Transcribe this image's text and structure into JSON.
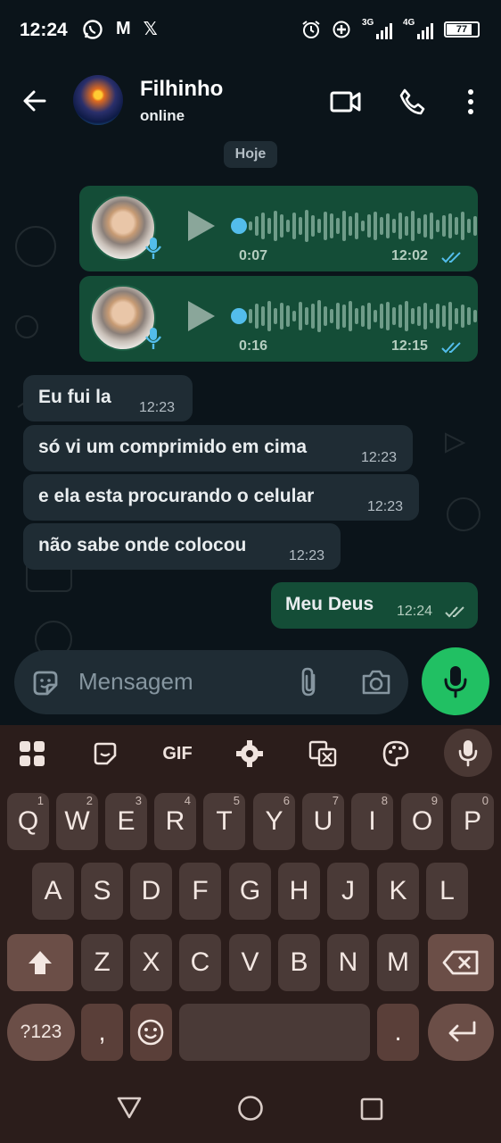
{
  "status_bar": {
    "time": "12:24",
    "left_icons": [
      "whatsapp-icon",
      "gmail-icon",
      "x-icon"
    ],
    "gmail_glyph": "M",
    "x_glyph": "𝕏",
    "network_1": "3G",
    "network_2": "4G",
    "battery": "77"
  },
  "header": {
    "contact_name": "Filhinho",
    "contact_status": "online"
  },
  "chat": {
    "date_chip": "Hoje",
    "voice_messages": [
      {
        "duration": "0:07",
        "time": "12:02",
        "read": true
      },
      {
        "duration": "0:16",
        "time": "12:15",
        "read": true
      }
    ],
    "incoming": [
      {
        "text": "Eu fui la",
        "time": "12:23"
      },
      {
        "text": "só vi um comprimido em cima",
        "time": "12:23"
      },
      {
        "text": "e ela esta procurando o celular",
        "time": "12:23"
      },
      {
        "text": "não sabe onde colocou",
        "time": "12:23"
      }
    ],
    "outgoing_text": {
      "text": "Meu Deus",
      "time": "12:24",
      "read": false
    }
  },
  "composer": {
    "placeholder": "Mensagem"
  },
  "keyboard": {
    "toolbar": {
      "gif_label": "GIF"
    },
    "row1": [
      {
        "key": "Q",
        "hint": "1"
      },
      {
        "key": "W",
        "hint": "2"
      },
      {
        "key": "E",
        "hint": "3"
      },
      {
        "key": "R",
        "hint": "4"
      },
      {
        "key": "T",
        "hint": "5"
      },
      {
        "key": "Y",
        "hint": "6"
      },
      {
        "key": "U",
        "hint": "7"
      },
      {
        "key": "I",
        "hint": "8"
      },
      {
        "key": "O",
        "hint": "9"
      },
      {
        "key": "P",
        "hint": "0"
      }
    ],
    "row2": [
      "A",
      "S",
      "D",
      "F",
      "G",
      "H",
      "J",
      "K",
      "L"
    ],
    "row3": [
      "Z",
      "X",
      "C",
      "V",
      "B",
      "N",
      "M"
    ],
    "row4": {
      "symbols": "?123",
      "comma": ",",
      "period": "."
    }
  },
  "colors": {
    "background": "#0b141a",
    "outgoing_bubble": "#144d37",
    "incoming_bubble": "#1f2c34",
    "accent_green": "#21c063",
    "read_ticks": "#53bdeb",
    "keyboard_bg": "#2b1d1b"
  }
}
